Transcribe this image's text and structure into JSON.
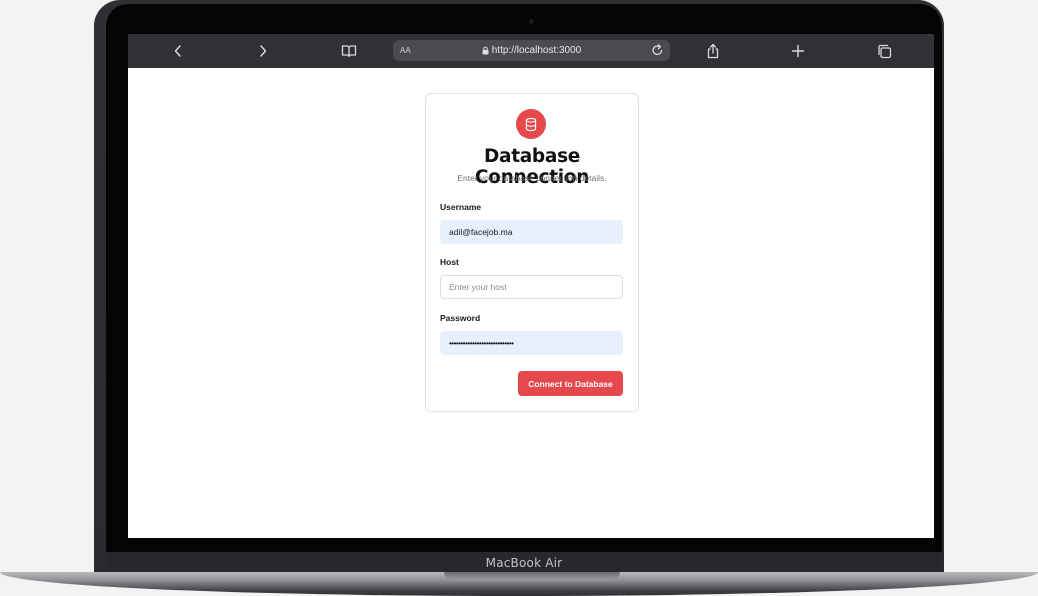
{
  "device": {
    "brand_label": "MacBook Air"
  },
  "browser": {
    "text_size_label": "AA",
    "url": "http://localhost:3000"
  },
  "form": {
    "title": "Database Connection",
    "subtitle": "Enter your database connection details.",
    "username": {
      "label": "Username",
      "value": "adil@facejob.ma",
      "placeholder": ""
    },
    "host": {
      "label": "Host",
      "value": "",
      "placeholder": "Enter your host"
    },
    "password": {
      "label": "Password",
      "value": "••••••••••••••••••••••••••••",
      "placeholder": ""
    },
    "submit_label": "Connect to Database"
  },
  "icons": {
    "back": "chevron-left-icon",
    "forward": "chevron-right-icon",
    "bookmarks": "book-icon",
    "lock": "lock-icon",
    "reload": "reload-icon",
    "share": "share-icon",
    "new_tab": "plus-icon",
    "tabs": "tabs-icon",
    "database": "database-icon"
  },
  "colors": {
    "accent": "#e5484d",
    "autofill": "#e8f0fe",
    "toolbar": "#303134"
  }
}
